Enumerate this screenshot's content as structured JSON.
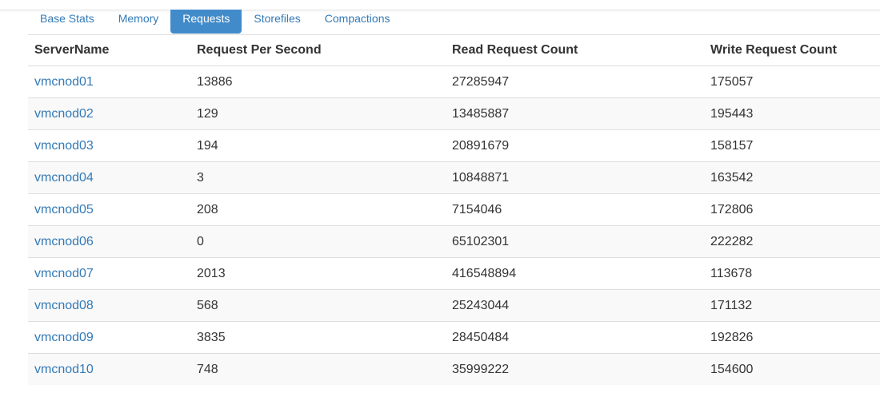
{
  "tabs": [
    {
      "label": "Base Stats",
      "active": false
    },
    {
      "label": "Memory",
      "active": false
    },
    {
      "label": "Requests",
      "active": true
    },
    {
      "label": "Storefiles",
      "active": false
    },
    {
      "label": "Compactions",
      "active": false
    }
  ],
  "table": {
    "headers": [
      "ServerName",
      "Request Per Second",
      "Read Request Count",
      "Write Request Count"
    ],
    "rows": [
      [
        "vmcnod01",
        "13886",
        "27285947",
        "175057"
      ],
      [
        "vmcnod02",
        "129",
        "13485887",
        "195443"
      ],
      [
        "vmcnod03",
        "194",
        "20891679",
        "158157"
      ],
      [
        "vmcnod04",
        "3",
        "10848871",
        "163542"
      ],
      [
        "vmcnod05",
        "208",
        "7154046",
        "172806"
      ],
      [
        "vmcnod06",
        "0",
        "65102301",
        "222282"
      ],
      [
        "vmcnod07",
        "2013",
        "416548894",
        "113678"
      ],
      [
        "vmcnod08",
        "568",
        "25243044",
        "171132"
      ],
      [
        "vmcnod09",
        "3835",
        "28450484",
        "192826"
      ],
      [
        "vmcnod10",
        "748",
        "35999222",
        "154600"
      ]
    ]
  },
  "colors": {
    "link": "#337ab7",
    "active_tab_bg": "#428bca",
    "stripe": "#f9f9f9",
    "border": "#dddddd"
  }
}
